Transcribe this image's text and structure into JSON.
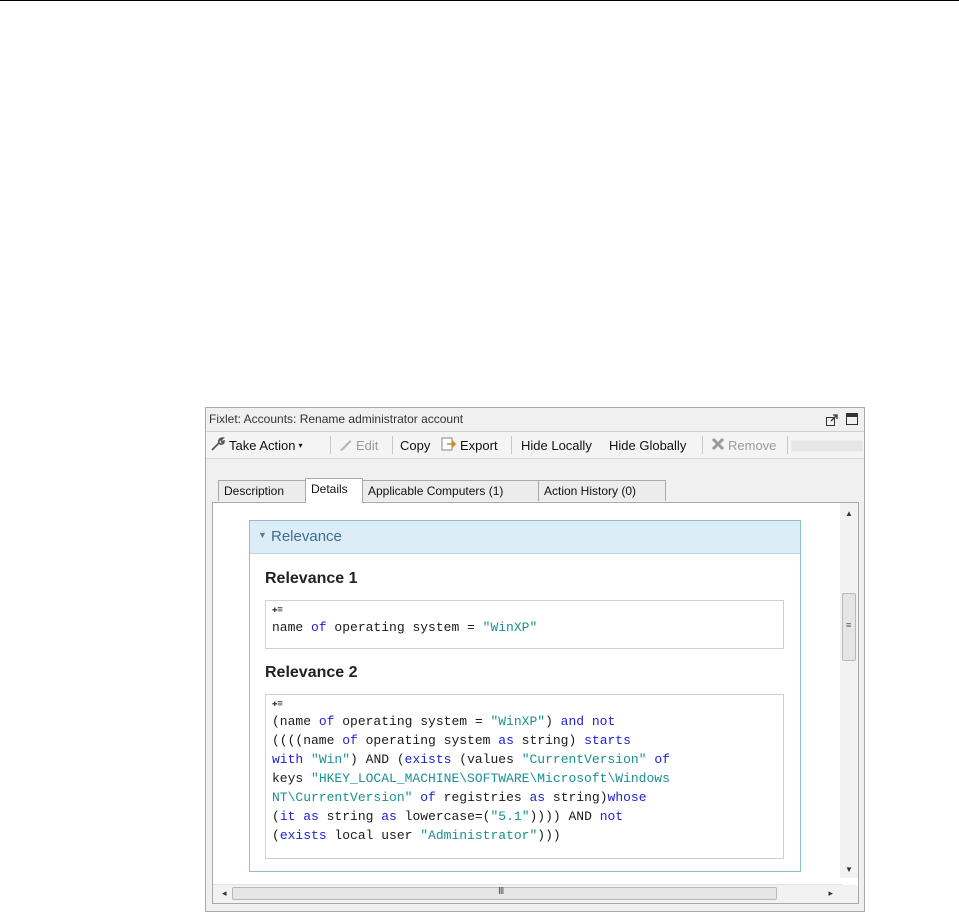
{
  "window": {
    "title": "Fixlet: Accounts: Rename administrator account"
  },
  "toolbar": {
    "take_action": "Take Action",
    "edit": "Edit",
    "copy": "Copy",
    "export": "Export",
    "hide_locally": "Hide Locally",
    "hide_globally": "Hide Globally",
    "remove": "Remove"
  },
  "tabs": [
    {
      "label": "Description"
    },
    {
      "label": "Details"
    },
    {
      "label": "Applicable Computers (1)"
    },
    {
      "label": "Action History (0)"
    }
  ],
  "active_tab": "Details",
  "section": {
    "title": "Relevance"
  },
  "relevance": [
    {
      "title": "Relevance 1",
      "code_lines": [
        [
          [
            "t",
            "name "
          ],
          [
            "k",
            "of"
          ],
          [
            "t",
            " operating system = "
          ],
          [
            "s",
            "\"WinXP\""
          ]
        ]
      ]
    },
    {
      "title": "Relevance 2",
      "code_lines": [
        [
          [
            "t",
            "(name "
          ],
          [
            "k",
            "of"
          ],
          [
            "t",
            " operating system = "
          ],
          [
            "s",
            "\"WinXP\""
          ],
          [
            "t",
            ") "
          ],
          [
            "k",
            "and not"
          ]
        ],
        [
          [
            "t",
            "((((name "
          ],
          [
            "k",
            "of"
          ],
          [
            "t",
            " operating system "
          ],
          [
            "k",
            "as"
          ],
          [
            "t",
            " string) "
          ],
          [
            "k",
            "starts"
          ]
        ],
        [
          [
            "k",
            "with"
          ],
          [
            "t",
            " "
          ],
          [
            "s",
            "\"Win\""
          ],
          [
            "t",
            ") AND ("
          ],
          [
            "k",
            "exists"
          ],
          [
            "t",
            " (values "
          ],
          [
            "s",
            "\"CurrentVersion\""
          ],
          [
            "t",
            " "
          ],
          [
            "k",
            "of"
          ]
        ],
        [
          [
            "t",
            "keys "
          ],
          [
            "s",
            "\"HKEY_LOCAL_MACHINE\\SOFTWARE\\Microsoft\\Windows"
          ]
        ],
        [
          [
            "s",
            "NT\\CurrentVersion\""
          ],
          [
            "t",
            " "
          ],
          [
            "k",
            "of"
          ],
          [
            "t",
            " registries "
          ],
          [
            "k",
            "as"
          ],
          [
            "t",
            " string)"
          ],
          [
            "k",
            "whose"
          ]
        ],
        [
          [
            "t",
            "("
          ],
          [
            "k",
            "it as"
          ],
          [
            "t",
            " string "
          ],
          [
            "k",
            "as"
          ],
          [
            "t",
            " lowercase=("
          ],
          [
            "s",
            "\"5.1\""
          ],
          [
            "t",
            ")))) AND "
          ],
          [
            "k",
            "not"
          ]
        ],
        [
          [
            "t",
            "("
          ],
          [
            "k",
            "exists"
          ],
          [
            "t",
            " local user "
          ],
          [
            "s",
            "\"Administrator\""
          ],
          [
            "t",
            ")))"
          ]
        ]
      ]
    }
  ],
  "icons": {
    "take_action": "wrench-icon",
    "dropdown": "chevron-down-icon",
    "edit": "pencil-icon",
    "export": "export-icon",
    "remove": "x-icon",
    "undock": "undock-icon",
    "maximize": "maximize-icon",
    "code": "evaluate-icon"
  },
  "colors": {
    "keyword": "#2020d8",
    "string": "#1a9090",
    "section_header_bg": "#dcedf8",
    "section_header_text": "#3d6e8f",
    "section_border": "#8fbcd6"
  }
}
